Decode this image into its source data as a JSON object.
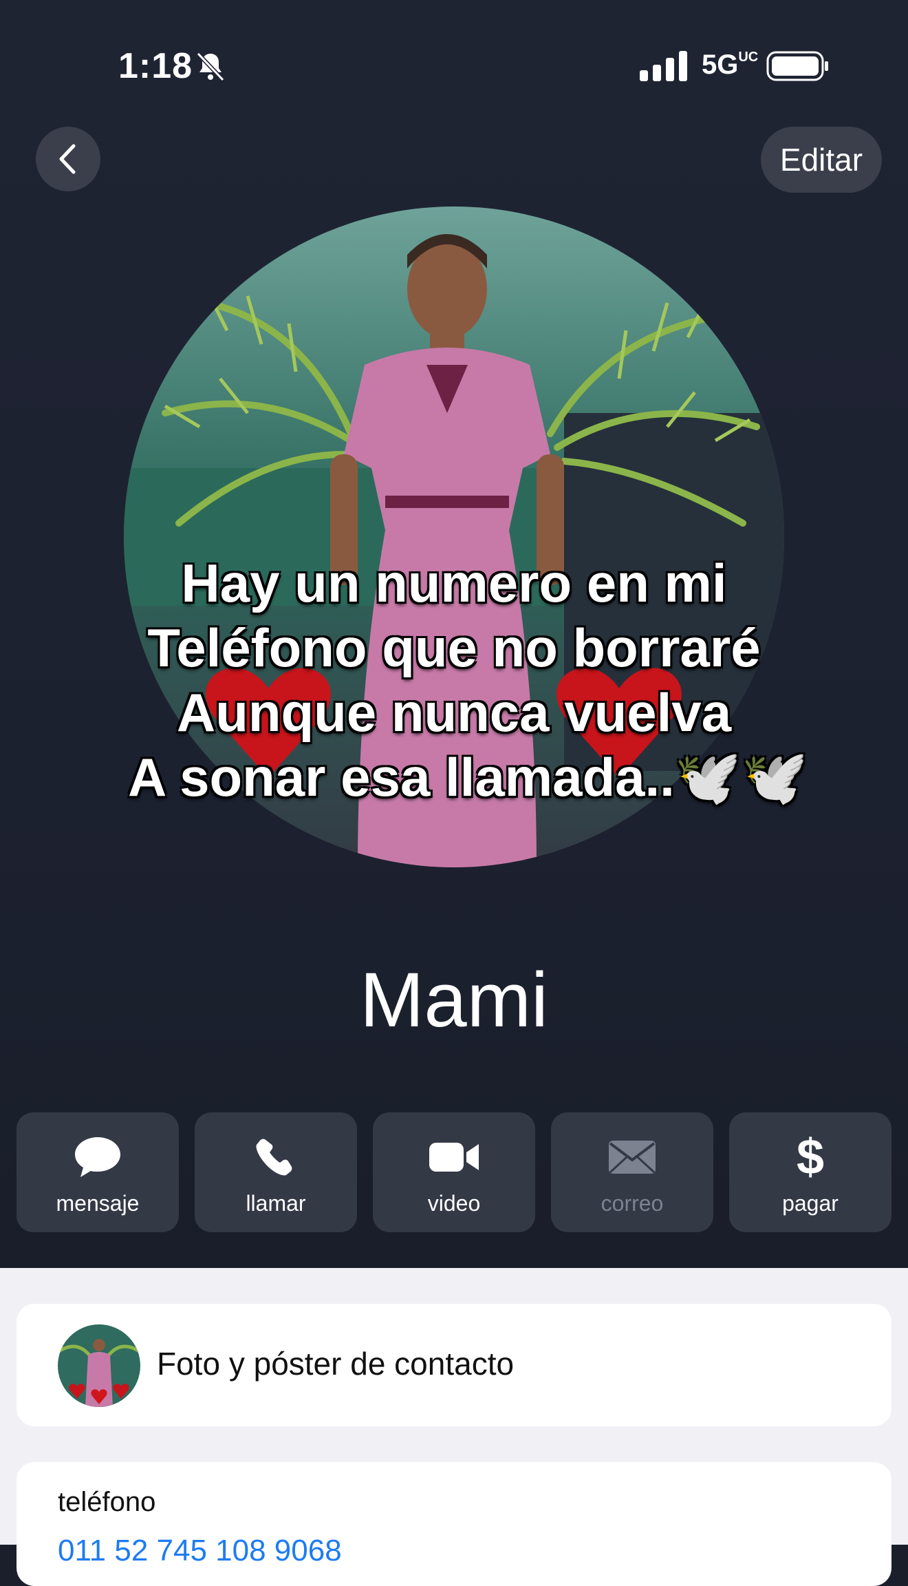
{
  "status_bar": {
    "time": "1:18",
    "network": "5G",
    "network_suffix": "UC",
    "icons": [
      "bell-slash-icon",
      "signal-icon",
      "battery-icon"
    ]
  },
  "nav": {
    "back_icon": "chevron-left-icon",
    "edit_label": "Editar"
  },
  "poster": {
    "lines": [
      "Hay un numero en mi",
      "Teléfono que no borraré",
      "Aunque nunca vuelva",
      "A sonar esa llamada..🕊️🕊️"
    ]
  },
  "contact": {
    "name": "Mami"
  },
  "actions": [
    {
      "label": "mensaje",
      "icon": "message-bubble-icon",
      "enabled": true
    },
    {
      "label": "llamar",
      "icon": "phone-icon",
      "enabled": true
    },
    {
      "label": "video",
      "icon": "video-camera-icon",
      "enabled": true
    },
    {
      "label": "correo",
      "icon": "envelope-icon",
      "enabled": false
    },
    {
      "label": "pagar",
      "icon": "dollar-icon",
      "enabled": true
    }
  ],
  "cards": {
    "photo_poster_label": "Foto y póster de contacto",
    "phone_label": "teléfono",
    "phone_number": "011 52 745 108 9068"
  },
  "colors": {
    "header_bg": "#1f2433",
    "button_bg": "#343946",
    "link_blue": "#1d7cf2",
    "list_bg": "#f0f0f5"
  }
}
